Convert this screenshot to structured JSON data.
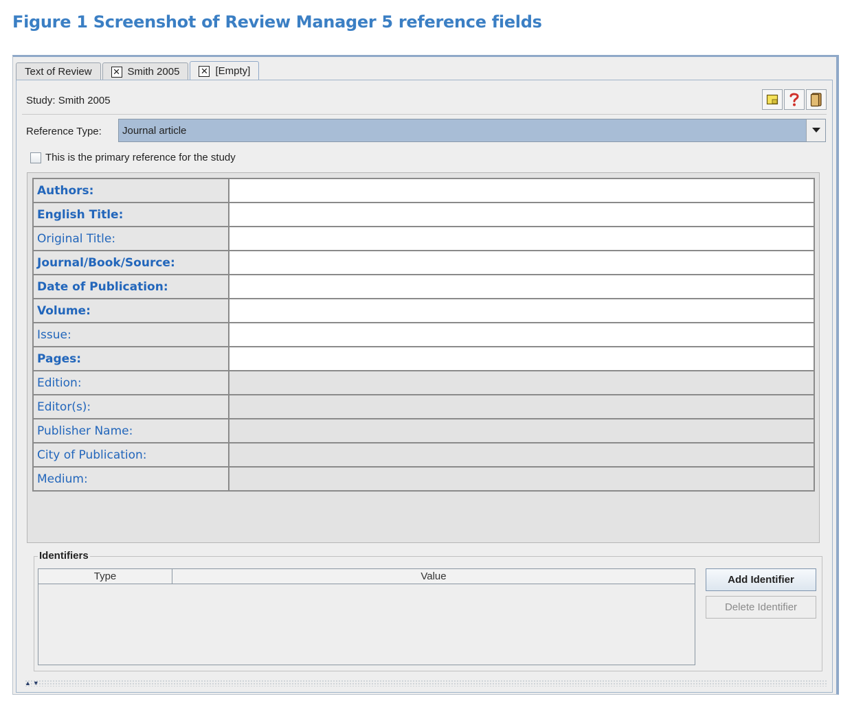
{
  "figure": {
    "title": "Figure 1 Screenshot of Review Manager 5 reference fields"
  },
  "tabs": [
    {
      "label": "Text of Review",
      "closable": false
    },
    {
      "label": "Smith 2005",
      "closable": true
    },
    {
      "label": "[Empty]",
      "closable": true,
      "active": true
    }
  ],
  "study": {
    "label": "Study: Smith 2005"
  },
  "toolbar": {
    "icons": [
      "note-icon",
      "help-icon",
      "book-icon"
    ]
  },
  "reference_type": {
    "label": "Reference Type:",
    "value": "Journal article"
  },
  "primary_checkbox": {
    "label": "This is the primary reference for the study",
    "checked": false
  },
  "fields": [
    {
      "label": "Authors:",
      "required": true,
      "enabled": true,
      "value": ""
    },
    {
      "label": "English Title:",
      "required": true,
      "enabled": true,
      "value": ""
    },
    {
      "label": "Original Title:",
      "required": false,
      "enabled": true,
      "value": ""
    },
    {
      "label": "Journal/Book/Source:",
      "required": true,
      "enabled": true,
      "value": ""
    },
    {
      "label": "Date of Publication:",
      "required": true,
      "enabled": true,
      "value": ""
    },
    {
      "label": "Volume:",
      "required": true,
      "enabled": true,
      "value": ""
    },
    {
      "label": "Issue:",
      "required": false,
      "enabled": true,
      "value": ""
    },
    {
      "label": "Pages:",
      "required": true,
      "enabled": true,
      "value": ""
    },
    {
      "label": "Edition:",
      "required": false,
      "enabled": false,
      "value": ""
    },
    {
      "label": "Editor(s):",
      "required": false,
      "enabled": false,
      "value": ""
    },
    {
      "label": "Publisher Name:",
      "required": false,
      "enabled": false,
      "value": ""
    },
    {
      "label": "City of Publication:",
      "required": false,
      "enabled": false,
      "value": ""
    },
    {
      "label": "Medium:",
      "required": false,
      "enabled": false,
      "value": ""
    }
  ],
  "identifiers": {
    "legend": "Identifiers",
    "columns": [
      "Type",
      "Value"
    ],
    "add_label": "Add Identifier",
    "delete_label": "Delete Identifier"
  },
  "colors": {
    "title_blue": "#3b7fc4",
    "field_label": "#2266bb",
    "select_bg": "#a8bdd6"
  }
}
